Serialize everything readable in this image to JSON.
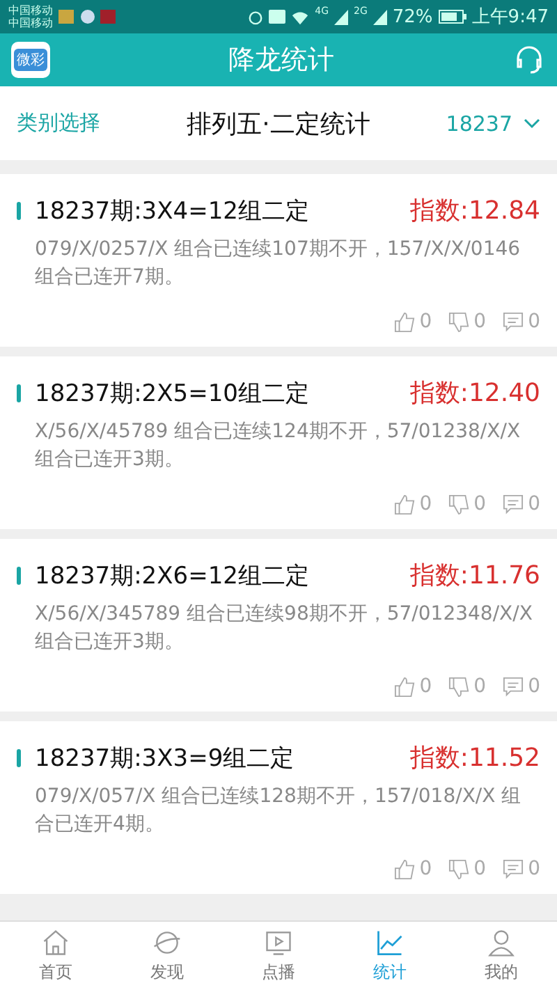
{
  "status_bar": {
    "carriers": [
      "中国移动",
      "中国移动"
    ],
    "network_labels": [
      "4G",
      "2G"
    ],
    "battery": "72%",
    "time": "上午9:47"
  },
  "header": {
    "logo_text": "微彩",
    "title": "降龙统计"
  },
  "filter_bar": {
    "category": "类别选择",
    "title": "排列五·二定统计",
    "issue": "18237"
  },
  "cards": [
    {
      "title": "18237期:3X4=12组二定",
      "index": "指数:12.84",
      "body": "079/X/0257/X 组合已连续107期不开，157/X/X/0146 组合已连开7期。",
      "likes": "0",
      "dislikes": "0",
      "comments": "0"
    },
    {
      "title": "18237期:2X5=10组二定",
      "index": "指数:12.40",
      "body": "X/56/X/45789 组合已连续124期不开，57/01238/X/X 组合已连开3期。",
      "likes": "0",
      "dislikes": "0",
      "comments": "0"
    },
    {
      "title": "18237期:2X6=12组二定",
      "index": "指数:11.76",
      "body": "X/56/X/345789 组合已连续98期不开，57/012348/X/X 组合已连开3期。",
      "likes": "0",
      "dislikes": "0",
      "comments": "0"
    },
    {
      "title": "18237期:3X3=9组二定",
      "index": "指数:11.52",
      "body": "079/X/057/X 组合已连续128期不开，157/018/X/X 组合已连开4期。",
      "likes": "0",
      "dislikes": "0",
      "comments": "0"
    }
  ],
  "tab_bar": [
    {
      "kind": "home",
      "label": "首页",
      "selected": false
    },
    {
      "kind": "discover",
      "label": "发现",
      "selected": false
    },
    {
      "kind": "play",
      "label": "点播",
      "selected": false
    },
    {
      "kind": "stats",
      "label": "统计",
      "selected": true
    },
    {
      "kind": "profile",
      "label": "我的",
      "selected": false
    }
  ]
}
